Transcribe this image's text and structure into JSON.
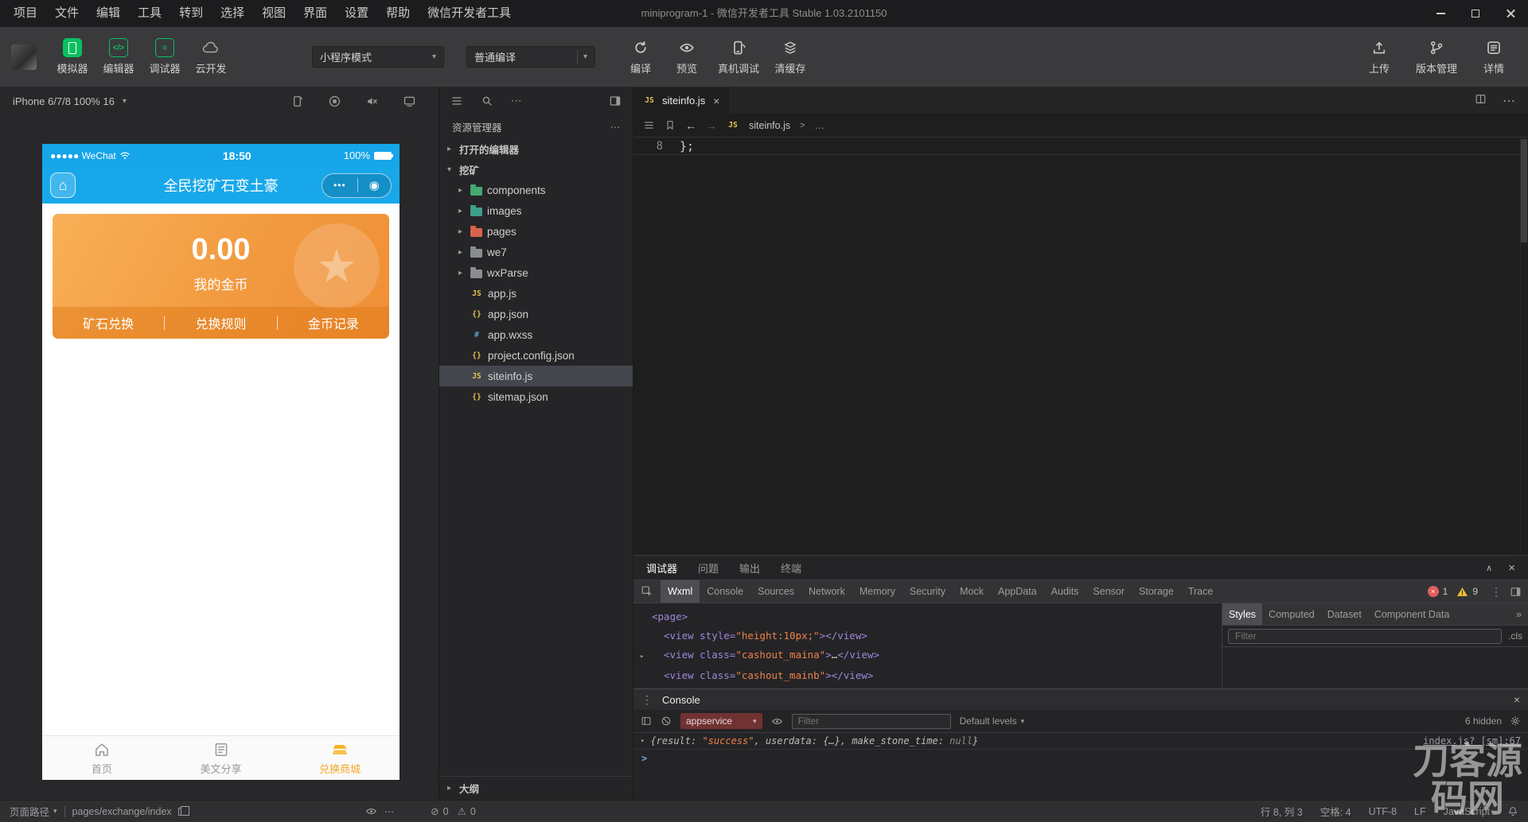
{
  "menubar": {
    "items": [
      "项目",
      "文件",
      "编辑",
      "工具",
      "转到",
      "选择",
      "视图",
      "界面",
      "设置",
      "帮助",
      "微信开发者工具"
    ],
    "title": "miniprogram-1 - 微信开发者工具 Stable 1.03.2101150"
  },
  "toolbar": {
    "simulator": "模拟器",
    "editor": "编辑器",
    "debugger": "调试器",
    "cloud": "云开发",
    "mode": "小程序模式",
    "compile_mode": "普通编译",
    "compile": "编译",
    "preview": "预览",
    "remote_debug": "真机调试",
    "clear_cache": "清缓存",
    "upload": "上传",
    "version": "版本管理",
    "details": "详情"
  },
  "simulator": {
    "device": "iPhone 6/7/8 100% 16",
    "phone": {
      "carrier": "●●●●● WeChat",
      "time": "18:50",
      "battery": "100%",
      "title": "全民挖矿石变土豪",
      "menu_dots": "•••",
      "amount": "0.00",
      "amount_label": "我的金币",
      "action1": "矿石兑换",
      "action2": "兑换规则",
      "action3": "金币记录",
      "tab1": "首页",
      "tab2": "美文分享",
      "tab3": "兑换商城"
    }
  },
  "explorer": {
    "title": "资源管理器",
    "open_editors": "打开的编辑器",
    "project": "挖矿",
    "outline": "大纲",
    "files": {
      "f1": "components",
      "f2": "images",
      "f3": "pages",
      "f4": "we7",
      "f5": "wxParse",
      "f6": "app.js",
      "f7": "app.json",
      "f8": "app.wxss",
      "f9": "project.config.json",
      "f10": "siteinfo.js",
      "f11": "sitemap.json"
    }
  },
  "editor": {
    "tab": "siteinfo.js",
    "breadcrumb": "siteinfo.js",
    "breadcrumb_more": "…",
    "line_no": "8",
    "code": "};"
  },
  "debug": {
    "tabs": {
      "t1": "调试器",
      "t2": "问题",
      "t3": "输出",
      "t4": "终端"
    },
    "devtools": {
      "d1": "Wxml",
      "d2": "Console",
      "d3": "Sources",
      "d4": "Network",
      "d5": "Memory",
      "d6": "Security",
      "d7": "Mock",
      "d8": "AppData",
      "d9": "Audits",
      "d10": "Sensor",
      "d11": "Storage",
      "d12": "Trace"
    },
    "errors": "1",
    "warnings": "9",
    "wxml": {
      "l1": "<page>",
      "l2a": "<view ",
      "l2b": "style=",
      "l2c": "\"height:10px;\"",
      "l2d": "></view>",
      "l3a": "<view ",
      "l3b": "class=",
      "l3c": "\"cashout_maina\"",
      "l3d": ">",
      "l3e": "…",
      "l3f": "</view>",
      "l4a": "<view ",
      "l4b": "class=",
      "l4c": "\"cashout_mainb\"",
      "l4d": "></view>"
    },
    "styles": {
      "s1": "Styles",
      "s2": "Computed",
      "s3": "Dataset",
      "s4": "Component Data",
      "filter": "Filter",
      "cls": ".cls"
    }
  },
  "console": {
    "title": "Console",
    "context": "appservice",
    "filter": "Filter",
    "levels": "Default levels",
    "hidden": "6 hidden",
    "log": {
      "p1": "{result: ",
      "p2": "\"success\"",
      "p3": ", userdata: ",
      "p4": "{…}",
      "p5": ", make_stone_time: ",
      "p6": "null",
      "p7": "}"
    },
    "source": "index.js? [sm]:67",
    "prompt": ">"
  },
  "statusbar": {
    "page_path": "页面路径",
    "path": "pages/exchange/index",
    "errors": "0",
    "warnings": "0",
    "cursor": "行 8, 列 3",
    "spaces": "空格: 4",
    "encoding": "UTF-8",
    "eol": "LF",
    "lang": "JavaScript"
  },
  "icons": {
    "chev_r": "▸",
    "chev_d": "▾",
    "caret": "▾",
    "close": "×",
    "dots_h": "⋯",
    "dots_v": "⋮",
    "back": "←",
    "fwd": "→",
    "gt": ">",
    "overflow": "»",
    "collapse": "∧",
    "star": "★",
    "js": "JS",
    "braces": "{}",
    "hash": "#",
    "code": "</>",
    "lines": "≡",
    "home": "⌂",
    "target": "◉",
    "warn": "⚠",
    "noent": "⊘"
  },
  "watermark": "刀客源码网"
}
